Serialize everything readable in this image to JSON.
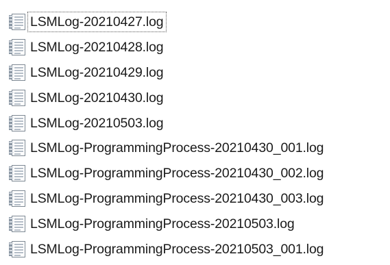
{
  "files": [
    {
      "name": "LSMLog-20210427.log",
      "icon": "log-file-icon",
      "focused": true
    },
    {
      "name": "LSMLog-20210428.log",
      "icon": "log-file-icon",
      "focused": false
    },
    {
      "name": "LSMLog-20210429.log",
      "icon": "log-file-icon",
      "focused": false
    },
    {
      "name": "LSMLog-20210430.log",
      "icon": "log-file-icon",
      "focused": false
    },
    {
      "name": "LSMLog-20210503.log",
      "icon": "log-file-icon",
      "focused": false
    },
    {
      "name": "LSMLog-ProgrammingProcess-20210430_001.log",
      "icon": "log-file-icon",
      "focused": false
    },
    {
      "name": "LSMLog-ProgrammingProcess-20210430_002.log",
      "icon": "log-file-icon",
      "focused": false
    },
    {
      "name": "LSMLog-ProgrammingProcess-20210430_003.log",
      "icon": "log-file-icon",
      "focused": false
    },
    {
      "name": "LSMLog-ProgrammingProcess-20210503.log",
      "icon": "log-file-icon",
      "focused": false
    },
    {
      "name": "LSMLog-ProgrammingProcess-20210503_001.log",
      "icon": "log-file-icon",
      "focused": false
    }
  ],
  "colors": {
    "icon_page": "#ffffff",
    "icon_border": "#7c8792",
    "icon_binding": "#8a96a3",
    "icon_lines": "#9aa7b4",
    "text": "#1a1a1a",
    "focus_border": "#555555"
  }
}
